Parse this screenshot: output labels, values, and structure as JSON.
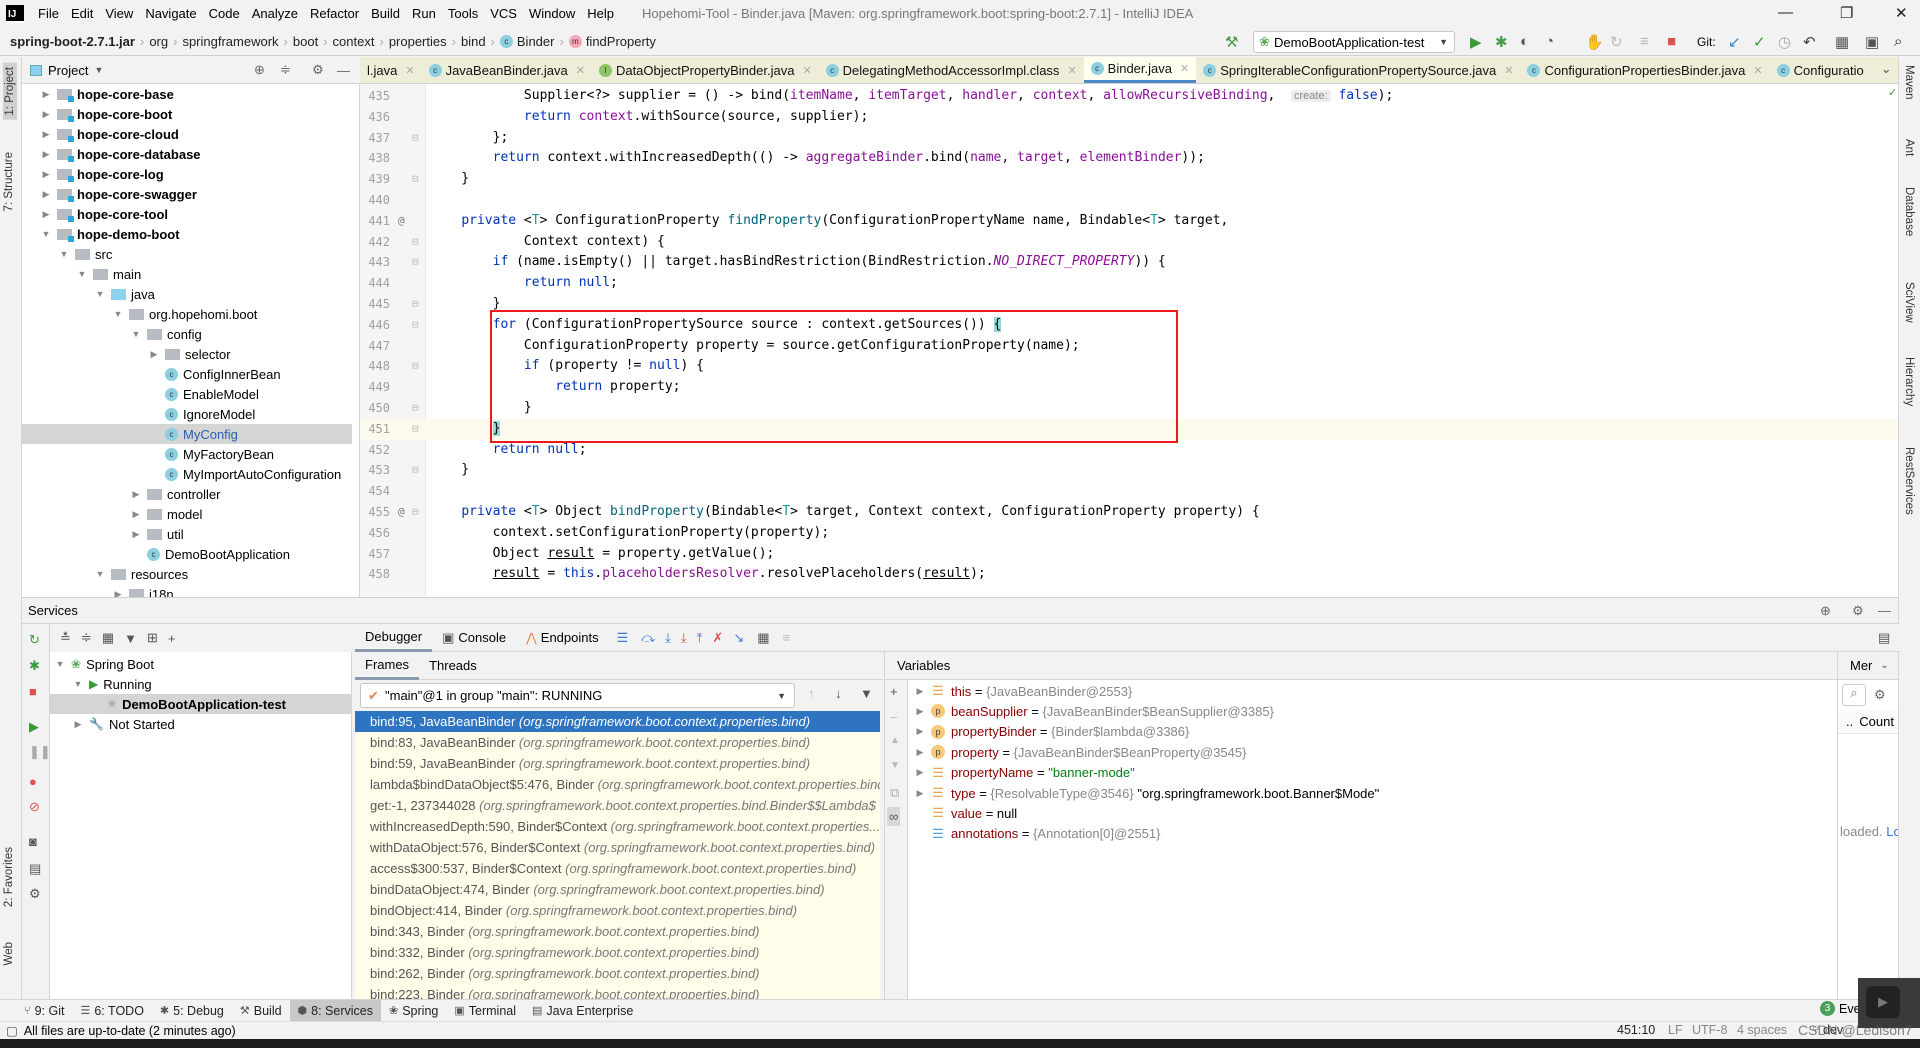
{
  "window": {
    "title": "Hopehomi-Tool - Binder.java [Maven: org.springframework.boot:spring-boot:2.7.1] - IntelliJ IDEA",
    "logo": "IJ",
    "menu": [
      "File",
      "Edit",
      "View",
      "Navigate",
      "Code",
      "Analyze",
      "Refactor",
      "Build",
      "Run",
      "Tools",
      "VCS",
      "Window",
      "Help"
    ]
  },
  "breadcrumb": [
    {
      "label": "spring-boot-2.7.1.jar",
      "icon": ""
    },
    {
      "label": "org",
      "icon": ""
    },
    {
      "label": "springframework",
      "icon": ""
    },
    {
      "label": "boot",
      "icon": ""
    },
    {
      "label": "context",
      "icon": ""
    },
    {
      "label": "properties",
      "icon": ""
    },
    {
      "label": "bind",
      "icon": ""
    },
    {
      "label": "Binder",
      "icon": "class-icon"
    },
    {
      "label": "findProperty",
      "icon": "method-icon"
    }
  ],
  "toolbar": {
    "run_config": "DemoBootApplication-test",
    "git_label": "Git:"
  },
  "left_strip": [
    "1: Project",
    "7: Structure",
    "2: Favorites",
    "Web"
  ],
  "right_strip": [
    "Maven",
    "Ant",
    "Database",
    "SciView",
    "Hierarchy",
    "RestServices"
  ],
  "project": {
    "title": "Project",
    "tree": [
      {
        "label": "hope-core-base",
        "level": 0,
        "arrow": "collapsed",
        "icon": "module",
        "bold": true
      },
      {
        "label": "hope-core-boot",
        "level": 0,
        "arrow": "collapsed",
        "icon": "module",
        "bold": true
      },
      {
        "label": "hope-core-cloud",
        "level": 0,
        "arrow": "collapsed",
        "icon": "module",
        "bold": true
      },
      {
        "label": "hope-core-database",
        "level": 0,
        "arrow": "collapsed",
        "icon": "module",
        "bold": true
      },
      {
        "label": "hope-core-log",
        "level": 0,
        "arrow": "collapsed",
        "icon": "module",
        "bold": true
      },
      {
        "label": "hope-core-swagger",
        "level": 0,
        "arrow": "collapsed",
        "icon": "module",
        "bold": true
      },
      {
        "label": "hope-core-tool",
        "level": 0,
        "arrow": "collapsed",
        "icon": "module",
        "bold": true
      },
      {
        "label": "hope-demo-boot",
        "level": 0,
        "arrow": "expanded",
        "icon": "module",
        "bold": true
      },
      {
        "label": "src",
        "level": 1,
        "arrow": "expanded",
        "icon": "folder"
      },
      {
        "label": "main",
        "level": 2,
        "arrow": "expanded",
        "icon": "folder"
      },
      {
        "label": "java",
        "level": 3,
        "arrow": "expanded",
        "icon": "source-folder"
      },
      {
        "label": "org.hopehomi.boot",
        "level": 4,
        "arrow": "expanded",
        "icon": "package"
      },
      {
        "label": "config",
        "level": 5,
        "arrow": "expanded",
        "icon": "package"
      },
      {
        "label": "selector",
        "level": 6,
        "arrow": "collapsed",
        "icon": "package"
      },
      {
        "label": "ConfigInnerBean",
        "level": 6,
        "arrow": "none",
        "icon": "class"
      },
      {
        "label": "EnableModel",
        "level": 6,
        "arrow": "none",
        "icon": "class"
      },
      {
        "label": "IgnoreModel",
        "level": 6,
        "arrow": "none",
        "icon": "class"
      },
      {
        "label": "MyConfig",
        "level": 6,
        "arrow": "none",
        "icon": "class",
        "selected": true
      },
      {
        "label": "MyFactoryBean",
        "level": 6,
        "arrow": "none",
        "icon": "class"
      },
      {
        "label": "MyImportAutoConfiguration",
        "level": 6,
        "arrow": "none",
        "icon": "class"
      },
      {
        "label": "controller",
        "level": 5,
        "arrow": "collapsed",
        "icon": "package"
      },
      {
        "label": "model",
        "level": 5,
        "arrow": "collapsed",
        "icon": "package"
      },
      {
        "label": "util",
        "level": 5,
        "arrow": "collapsed",
        "icon": "package"
      },
      {
        "label": "DemoBootApplication",
        "level": 5,
        "arrow": "none",
        "icon": "spring-class"
      },
      {
        "label": "resources",
        "level": 3,
        "arrow": "expanded",
        "icon": "resources-folder"
      },
      {
        "label": "i18n",
        "level": 4,
        "arrow": "collapsed",
        "icon": "folder"
      }
    ]
  },
  "editor_tabs": [
    {
      "label": "l.java",
      "icon": "",
      "active": false
    },
    {
      "label": "JavaBeanBinder.java",
      "icon": "class-icon",
      "active": false
    },
    {
      "label": "DataObjectPropertyBinder.java",
      "icon": "interface-icon",
      "active": false
    },
    {
      "label": "DelegatingMethodAccessorImpl.class",
      "icon": "class-icon",
      "active": false
    },
    {
      "label": "Binder.java",
      "icon": "class-icon",
      "active": true
    },
    {
      "label": "SpringIterableConfigurationPropertySource.java",
      "icon": "class-icon",
      "active": false
    },
    {
      "label": "ConfigurationPropertiesBinder.java",
      "icon": "class-icon",
      "active": false
    },
    {
      "label": "Configuratio",
      "icon": "class-icon",
      "active": false,
      "truncated": true
    }
  ],
  "code": {
    "current_line": 451,
    "lines": [
      {
        "n": 435,
        "t": [
          [
            "            Supplier<?> supplier = () -> bind(",
            ""
          ],
          [
            "itemName",
            "fld"
          ],
          [
            ", ",
            ""
          ],
          [
            "itemTarget",
            "fld"
          ],
          [
            ", ",
            ""
          ],
          [
            "handler",
            "fld"
          ],
          [
            ", ",
            ""
          ],
          [
            "context",
            "fld"
          ],
          [
            ", ",
            ""
          ],
          [
            "allowRecursiveBinding",
            "fld"
          ],
          [
            ",  ",
            ""
          ],
          [
            "create:",
            "hint"
          ],
          [
            " ",
            ""
          ],
          [
            "false",
            "kw"
          ],
          [
            ");",
            ""
          ]
        ]
      },
      {
        "n": 436,
        "t": [
          [
            "            ",
            ""
          ],
          [
            "return",
            "kw"
          ],
          [
            " ",
            ""
          ],
          [
            "context",
            "fld"
          ],
          [
            ".withSource(source, supplier);",
            ""
          ]
        ]
      },
      {
        "n": 437,
        "t": [
          [
            "        };",
            ""
          ]
        ],
        "fold": true
      },
      {
        "n": 438,
        "t": [
          [
            "        ",
            ""
          ],
          [
            "return",
            "kw"
          ],
          [
            " context.withIncreasedDepth(() -> ",
            ""
          ],
          [
            "aggregateBinder",
            "fld"
          ],
          [
            ".bind(",
            ""
          ],
          [
            "name",
            "fld"
          ],
          [
            ", ",
            ""
          ],
          [
            "target",
            "fld"
          ],
          [
            ", ",
            ""
          ],
          [
            "elementBinder",
            "fld"
          ],
          [
            "));",
            ""
          ]
        ]
      },
      {
        "n": 439,
        "t": [
          [
            "    }",
            ""
          ]
        ],
        "fold": true
      },
      {
        "n": 440,
        "t": []
      },
      {
        "n": 441,
        "t": [
          [
            "    ",
            ""
          ],
          [
            "private",
            "kw"
          ],
          [
            " <",
            ""
          ],
          [
            "T",
            "tp"
          ],
          [
            "> ConfigurationProperty ",
            ""
          ],
          [
            "findProperty",
            "mth"
          ],
          [
            "(ConfigurationPropertyName name, Bindable<",
            ""
          ],
          [
            "T",
            "tp"
          ],
          [
            "> target,",
            ""
          ]
        ],
        "marker": "@"
      },
      {
        "n": 442,
        "t": [
          [
            "            Context context) {",
            ""
          ]
        ],
        "fold": true
      },
      {
        "n": 443,
        "t": [
          [
            "        ",
            ""
          ],
          [
            "if",
            "kw"
          ],
          [
            " (name.isEmpty() || target.hasBindRestriction(BindRestriction.",
            ""
          ],
          [
            "NO_DIRECT_PROPERTY",
            "cst"
          ],
          [
            ")) {",
            ""
          ]
        ],
        "fold": true
      },
      {
        "n": 444,
        "t": [
          [
            "            ",
            ""
          ],
          [
            "return",
            "kw"
          ],
          [
            " ",
            ""
          ],
          [
            "null",
            "kw"
          ],
          [
            ";",
            ""
          ]
        ]
      },
      {
        "n": 445,
        "t": [
          [
            "        }",
            ""
          ]
        ],
        "fold": true
      },
      {
        "n": 446,
        "t": [
          [
            "        ",
            ""
          ],
          [
            "for",
            "kw"
          ],
          [
            " (ConfigurationPropertySource source : context.getSources()) ",
            ""
          ],
          [
            "{",
            "brc"
          ]
        ],
        "fold": true
      },
      {
        "n": 447,
        "t": [
          [
            "            ConfigurationProperty property = source.getConfigurationProperty(name);",
            ""
          ]
        ]
      },
      {
        "n": 448,
        "t": [
          [
            "            ",
            ""
          ],
          [
            "if",
            "kw"
          ],
          [
            " (property != ",
            ""
          ],
          [
            "null",
            "kw"
          ],
          [
            ") {",
            ""
          ]
        ],
        "fold": true
      },
      {
        "n": 449,
        "t": [
          [
            "                ",
            ""
          ],
          [
            "return",
            "kw"
          ],
          [
            " property;",
            ""
          ]
        ]
      },
      {
        "n": 450,
        "t": [
          [
            "            }",
            ""
          ]
        ],
        "fold": true
      },
      {
        "n": 451,
        "t": [
          [
            "        ",
            ""
          ],
          [
            "}",
            "brc"
          ]
        ],
        "fold": true
      },
      {
        "n": 452,
        "t": [
          [
            "        ",
            ""
          ],
          [
            "return",
            "kw"
          ],
          [
            " ",
            ""
          ],
          [
            "null",
            "kw"
          ],
          [
            ";",
            ""
          ]
        ]
      },
      {
        "n": 453,
        "t": [
          [
            "    }",
            ""
          ]
        ],
        "fold": true
      },
      {
        "n": 454,
        "t": []
      },
      {
        "n": 455,
        "t": [
          [
            "    ",
            ""
          ],
          [
            "private",
            "kw"
          ],
          [
            " <",
            ""
          ],
          [
            "T",
            "tp"
          ],
          [
            "> Object ",
            ""
          ],
          [
            "bindProperty",
            "mth"
          ],
          [
            "(Bindable<",
            ""
          ],
          [
            "T",
            "tp"
          ],
          [
            "> target, Context context, ConfigurationProperty property) {",
            ""
          ]
        ],
        "marker": "@",
        "fold": true
      },
      {
        "n": 456,
        "t": [
          [
            "        context.setConfigurationProperty(property);",
            ""
          ]
        ]
      },
      {
        "n": 457,
        "t": [
          [
            "        Object ",
            ""
          ],
          [
            "result",
            "ul"
          ],
          [
            " = property.getValue();",
            ""
          ]
        ]
      },
      {
        "n": 458,
        "t": [
          [
            "        ",
            ""
          ],
          [
            "result",
            "ul"
          ],
          [
            " = ",
            ""
          ],
          [
            "this",
            "kw"
          ],
          [
            ".",
            ""
          ],
          [
            "placeholdersResolver",
            "fld"
          ],
          [
            ".resolvePlaceholders(",
            ""
          ],
          [
            "result",
            "ul"
          ],
          [
            ");",
            ""
          ]
        ]
      }
    ]
  },
  "services": {
    "title": "Services",
    "tree": [
      {
        "label": "Spring Boot",
        "level": 0,
        "arrow": "expanded",
        "icon": "spring-boot-icon"
      },
      {
        "label": "Running",
        "level": 1,
        "arrow": "expanded",
        "icon": "run-icon"
      },
      {
        "label": "DemoBootApplication-test",
        "level": 2,
        "arrow": "none",
        "icon": "loading-icon",
        "selected": true
      },
      {
        "label": "Not Started",
        "level": 1,
        "arrow": "collapsed",
        "icon": "wrench-icon"
      }
    ]
  },
  "debugger": {
    "tabs": [
      "Debugger",
      "Console",
      "Endpoints"
    ],
    "frame_tabs": [
      "Frames",
      "Threads"
    ],
    "thread": "\"main\"@1 in group \"main\": RUNNING",
    "frames": [
      {
        "method": "bind:95, JavaBeanBinder",
        "pkg": "(org.springframework.boot.context.properties.bind)"
      },
      {
        "method": "bind:83, JavaBeanBinder",
        "pkg": "(org.springframework.boot.context.properties.bind)"
      },
      {
        "method": "bind:59, JavaBeanBinder",
        "pkg": "(org.springframework.boot.context.properties.bind)"
      },
      {
        "method": "lambda$bindDataObject$5:476, Binder",
        "pkg": "(org.springframework.boot.context.properties.bind)"
      },
      {
        "method": "get:-1, 237344028",
        "pkg": "(org.springframework.boot.context.properties.bind.Binder$$Lambda$"
      },
      {
        "method": "withIncreasedDepth:590, Binder$Context",
        "pkg": "(org.springframework.boot.context.properties..."
      },
      {
        "method": "withDataObject:576, Binder$Context",
        "pkg": "(org.springframework.boot.context.properties.bind)"
      },
      {
        "method": "access$300:537, Binder$Context",
        "pkg": "(org.springframework.boot.context.properties.bind)"
      },
      {
        "method": "bindDataObject:474, Binder",
        "pkg": "(org.springframework.boot.context.properties.bind)"
      },
      {
        "method": "bindObject:414, Binder",
        "pkg": "(org.springframework.boot.context.properties.bind)"
      },
      {
        "method": "bind:343, Binder",
        "pkg": "(org.springframework.boot.context.properties.bind)"
      },
      {
        "method": "bind:332, Binder",
        "pkg": "(org.springframework.boot.context.properties.bind)"
      },
      {
        "method": "bind:262, Binder",
        "pkg": "(org.springframework.boot.context.properties.bind)"
      },
      {
        "method": "bind:223, Binder",
        "pkg": "(org.springframework.boot.context.properties.bind)"
      }
    ],
    "variables_title": "Variables",
    "variables": [
      {
        "name": "this",
        "value": "{JavaBeanBinder@2553}",
        "extra": "",
        "icon": "field",
        "expandable": true
      },
      {
        "name": "beanSupplier",
        "value": "{JavaBeanBinder$BeanSupplier@3385}",
        "extra": "",
        "icon": "parameter",
        "expandable": true
      },
      {
        "name": "propertyBinder",
        "value": "{Binder$lambda@3386}",
        "extra": "",
        "icon": "parameter",
        "expandable": true
      },
      {
        "name": "property",
        "value": "{JavaBeanBinder$BeanProperty@3545}",
        "extra": "",
        "icon": "parameter",
        "expandable": true
      },
      {
        "name": "propertyName",
        "value": "",
        "extra": "\"banner-mode\"",
        "kind": "string",
        "icon": "field",
        "expandable": true
      },
      {
        "name": "type",
        "value": "{ResolvableType@3546}",
        "extra": "\"org.springframework.boot.Banner$Mode\"",
        "icon": "field",
        "expandable": true
      },
      {
        "name": "value",
        "value": "",
        "extra": "null",
        "icon": "field",
        "expandable": false
      },
      {
        "name": "annotations",
        "value": "{Annotation[0]@2551}",
        "extra": "",
        "icon": "array",
        "expandable": false
      }
    ],
    "memory": {
      "tab": "Mer",
      "col1": "..",
      "col2": "Count",
      "message": "loaded.",
      "link": "Lo"
    }
  },
  "bottom_tabs": [
    {
      "label": "9: Git",
      "icon": "git-icon"
    },
    {
      "label": "6: TODO",
      "icon": "todo-icon"
    },
    {
      "label": "5: Debug",
      "icon": "bug-icon"
    },
    {
      "label": "Build",
      "icon": "hammer-icon"
    },
    {
      "label": "8: Services",
      "icon": "services-icon",
      "active": true
    },
    {
      "label": "Spring",
      "icon": "spring-icon"
    },
    {
      "label": "Terminal",
      "icon": "terminal-icon"
    },
    {
      "label": "Java Enterprise",
      "icon": "java-enterprise-icon"
    }
  ],
  "event_log": {
    "count": "3",
    "label": "Even"
  },
  "status": {
    "message": "All files are up-to-date (2 minutes ago)",
    "position": "451:10",
    "line_sep": "LF",
    "encoding": "UTF-8",
    "indent": "4 spaces",
    "branch": "dev"
  },
  "watermark": "CSDN @Ledison7"
}
